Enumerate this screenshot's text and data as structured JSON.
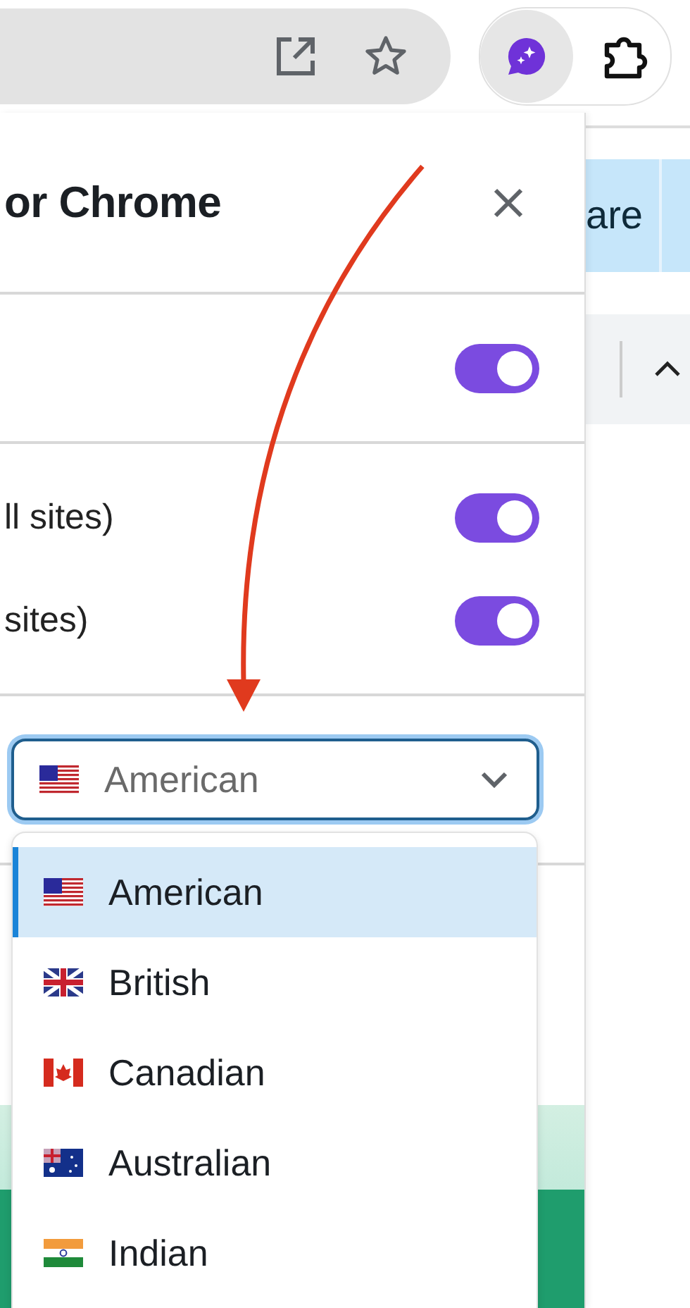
{
  "panel": {
    "title": "or Chrome",
    "toggle_groups": [
      [
        {
          "on": true
        }
      ],
      [
        {
          "label": "ll sites)",
          "on": true
        },
        {
          "label": "sites)",
          "on": true
        }
      ]
    ],
    "language_select": {
      "value": "American",
      "kind": "us",
      "expanded": true,
      "options": [
        {
          "label": "American",
          "kind": "us",
          "selected": true
        },
        {
          "label": "British",
          "kind": "gb",
          "selected": false
        },
        {
          "label": "Canadian",
          "kind": "ca",
          "selected": false
        },
        {
          "label": "Australian",
          "kind": "au",
          "selected": false
        },
        {
          "label": "Indian",
          "kind": "in",
          "selected": false
        }
      ]
    }
  },
  "page": {
    "tab": {
      "label": "are"
    }
  }
}
